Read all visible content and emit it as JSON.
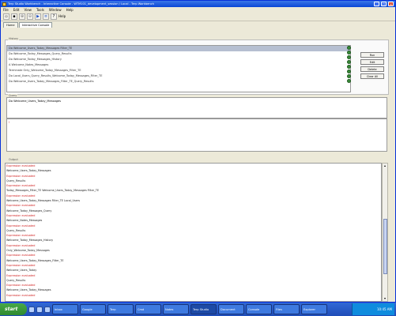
{
  "window": {
    "title": "Terp Studio Workbench - Interactive Console - WTM101_development_session / Local - Terp Workbench"
  },
  "menu": [
    "File",
    "Edit",
    "View",
    "Tools",
    "Window",
    "Help"
  ],
  "toolbar": {
    "buttons": [
      "new-icon",
      "save-icon",
      "zoom-in-icon",
      "zoom-out-icon",
      "run-icon",
      "filter-icon",
      "help-icon"
    ],
    "help_label": "Help"
  },
  "tabs": [
    "Home",
    "Interactive Console"
  ],
  "history_panel": {
    "legend": "History",
    "rows": [
      "Do Welcome_Users_Today_Messages Filter_TE",
      "Do Welcome_Today_Messages_Query_Results",
      "Do Welcome_Today_Messages_History",
      "A Welcome_Notes_Messages",
      "Terminate Only_Welcome_Today_Messages_Filter_TE",
      "Do Local_Users_Query_Results_Welcome_Today_Messages_Filter_TE",
      "Do Welcome_Users_Today_Messages_Filter_TE_Query_Results"
    ],
    "side_buttons": [
      "Run",
      "Edit",
      "Delete",
      "Clear All"
    ]
  },
  "query_panel": {
    "legend": "Query",
    "text": "Do Welcome_Users_Today_Messages"
  },
  "error_panel": {
    "text": "!"
  },
  "console": {
    "legend": "Output",
    "lines": [
      {
        "t": "Expression evaluated",
        "c": "red"
      },
      {
        "t": "Welcome_Users_Today_Messages",
        "c": "blk"
      },
      {
        "t": "Expression evaluated",
        "c": "red"
      },
      {
        "t": "Query_Results",
        "c": "blk"
      },
      {
        "t": "Expression evaluated",
        "c": "red"
      },
      {
        "t": "Today_Messages_Filter_TE  Welcome_Users_Today_Messages  Filter_TE",
        "c": "blk"
      },
      {
        "t": "Expression evaluated",
        "c": "red"
      },
      {
        "t": "Welcome_Users_Today_Messages  Filter_TE  Local_Users",
        "c": "blk"
      },
      {
        "t": "Expression evaluated",
        "c": "red"
      },
      {
        "t": "Welcome_Today_Messages_Query",
        "c": "blk"
      },
      {
        "t": "Expression evaluated",
        "c": "red"
      },
      {
        "t": "Welcome_Notes_Messages",
        "c": "blk"
      },
      {
        "t": "Expression evaluated",
        "c": "red"
      },
      {
        "t": "Query_Results",
        "c": "blk"
      },
      {
        "t": "Expression evaluated",
        "c": "red"
      },
      {
        "t": "Welcome_Today_Messages_History",
        "c": "blk"
      },
      {
        "t": "Expression evaluated",
        "c": "red"
      },
      {
        "t": "Only_Welcome_Today_Messages",
        "c": "blk"
      },
      {
        "t": "Expression evaluated",
        "c": "red"
      },
      {
        "t": "Welcome_Users_Today_Messages_Filter_TE",
        "c": "blk"
      },
      {
        "t": "Expression evaluated",
        "c": "red"
      },
      {
        "t": "Welcome_Users_Today",
        "c": "blk"
      },
      {
        "t": "Expression evaluated",
        "c": "red"
      },
      {
        "t": "Query_Results",
        "c": "blk"
      },
      {
        "t": "Expression evaluated",
        "c": "red"
      },
      {
        "t": "Welcome_Users_Today_Messages",
        "c": "blk"
      },
      {
        "t": "Expression evaluated",
        "c": "red"
      }
    ]
  },
  "taskbar": {
    "start": "start",
    "tasks": [
      "Inbox",
      "Google",
      "Terp",
      "Cmd",
      "Notes",
      "Terp Studio",
      "Document",
      "Console",
      "Files",
      "Explorer"
    ],
    "clock": "10:45 AM"
  }
}
